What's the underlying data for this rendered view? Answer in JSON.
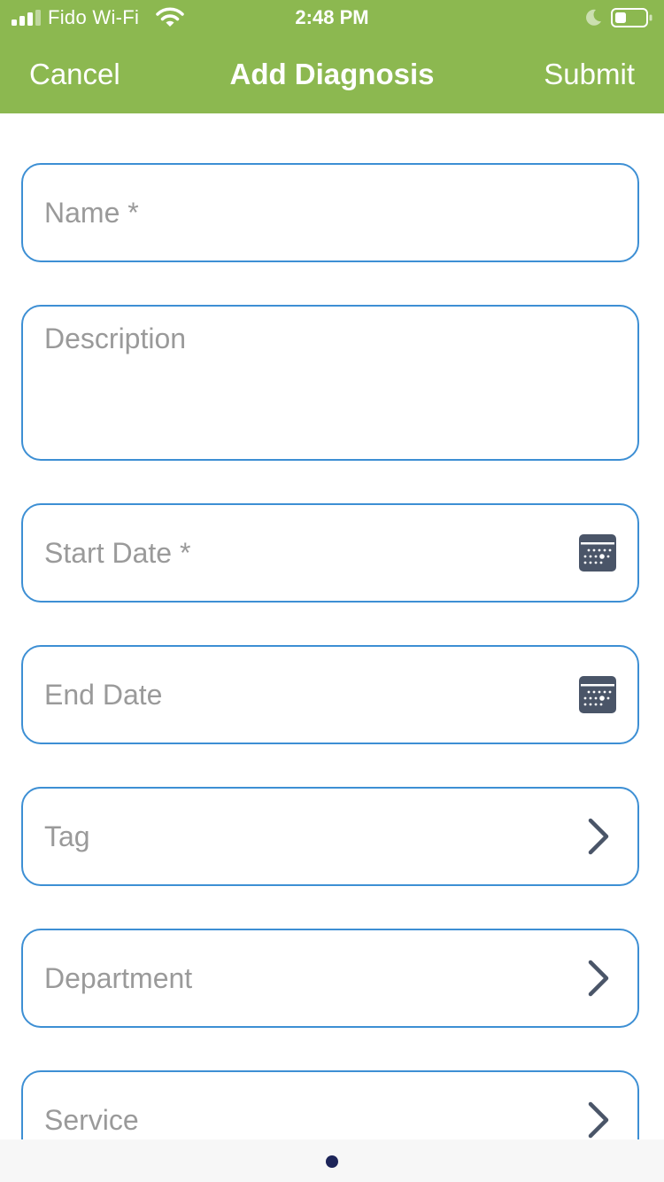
{
  "status_bar": {
    "carrier": "Fido Wi-Fi",
    "time": "2:48 PM",
    "icons": [
      "signal-bars-icon",
      "wifi-icon",
      "moon-icon",
      "battery-icon"
    ]
  },
  "nav": {
    "cancel_label": "Cancel",
    "title": "Add Diagnosis",
    "submit_label": "Submit"
  },
  "form": {
    "name_placeholder": "Name *",
    "description_placeholder": "Description",
    "start_date_placeholder": "Start Date *",
    "end_date_placeholder": "End Date",
    "tag_label": "Tag",
    "department_label": "Department",
    "service_label": "Service"
  },
  "colors": {
    "header_bg": "#8cb850",
    "field_border": "#3d8fd4",
    "placeholder_text": "#9a9a9a",
    "icon_color": "#4a5568",
    "page_dot": "#1d2559"
  },
  "page_indicator": {
    "pages": 1,
    "current": 1
  }
}
